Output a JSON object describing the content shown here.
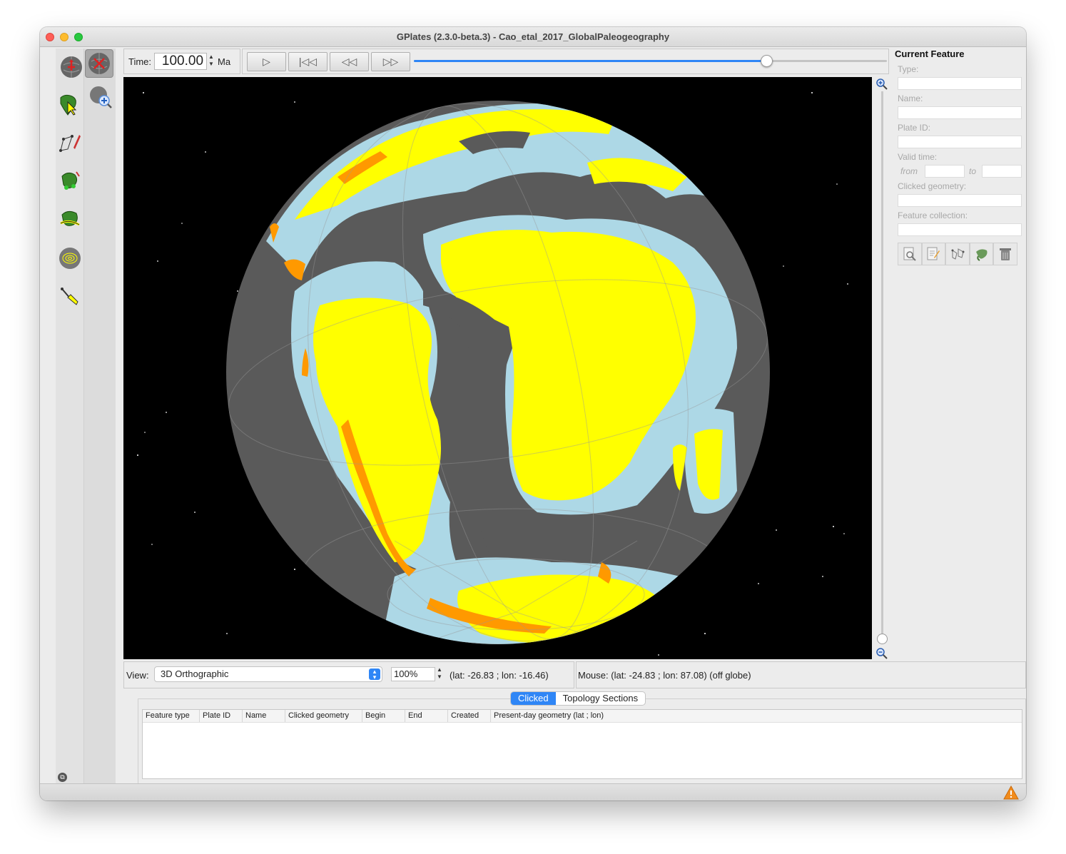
{
  "window": {
    "title": "GPlates (2.3.0-beta.3) - Cao_etal_2017_GlobalPaleogeography"
  },
  "time": {
    "label": "Time:",
    "value": "100.00",
    "unit": "Ma"
  },
  "animation": {
    "slider_fraction": 0.745,
    "buttons": [
      "play",
      "reset-to-start",
      "step-back",
      "step-forward"
    ]
  },
  "tools": {
    "column1": [
      "drag-globe-icon",
      "choose-feature-icon",
      "digitise-geometry-icon",
      "move-vertex-icon",
      "build-topology-icon",
      "measure-distance-icon",
      "small-circle-icon"
    ],
    "column2": [
      "zoom-globe-icon"
    ]
  },
  "current_feature": {
    "title": "Current Feature",
    "type_label": "Type:",
    "name_label": "Name:",
    "plate_id_label": "Plate ID:",
    "valid_time_label": "Valid time:",
    "from_label": "from",
    "to_label": "to",
    "clicked_geometry_label": "Clicked geometry:",
    "feature_collection_label": "Feature collection:",
    "action_icons": [
      "query-feature-icon",
      "edit-feature-icon",
      "clone-geometry-icon",
      "reconstruction-icon",
      "delete-feature-icon"
    ]
  },
  "view_bar": {
    "label": "View:",
    "projection": "3D Orthographic",
    "zoom": "100%",
    "camera_coords": "(lat: -26.83 ; lon: -16.46)"
  },
  "mouse_bar": {
    "text": "Mouse: (lat: -24.83 ; lon: 87.08) (off globe)"
  },
  "tabs": [
    {
      "label": "Clicked",
      "active": true
    },
    {
      "label": "Topology Sections",
      "active": false
    }
  ],
  "table": {
    "columns": [
      "Feature type",
      "Plate ID",
      "Name",
      "Clicked geometry",
      "Begin",
      "End",
      "Created",
      "Present-day geometry (lat ; lon)"
    ]
  },
  "colors": {
    "land": "#ffff00",
    "shallow_marine": "#add8e6",
    "deep_ocean": "#5a5a5a",
    "mountains": "#ff9900",
    "accent": "#2f86f6"
  }
}
